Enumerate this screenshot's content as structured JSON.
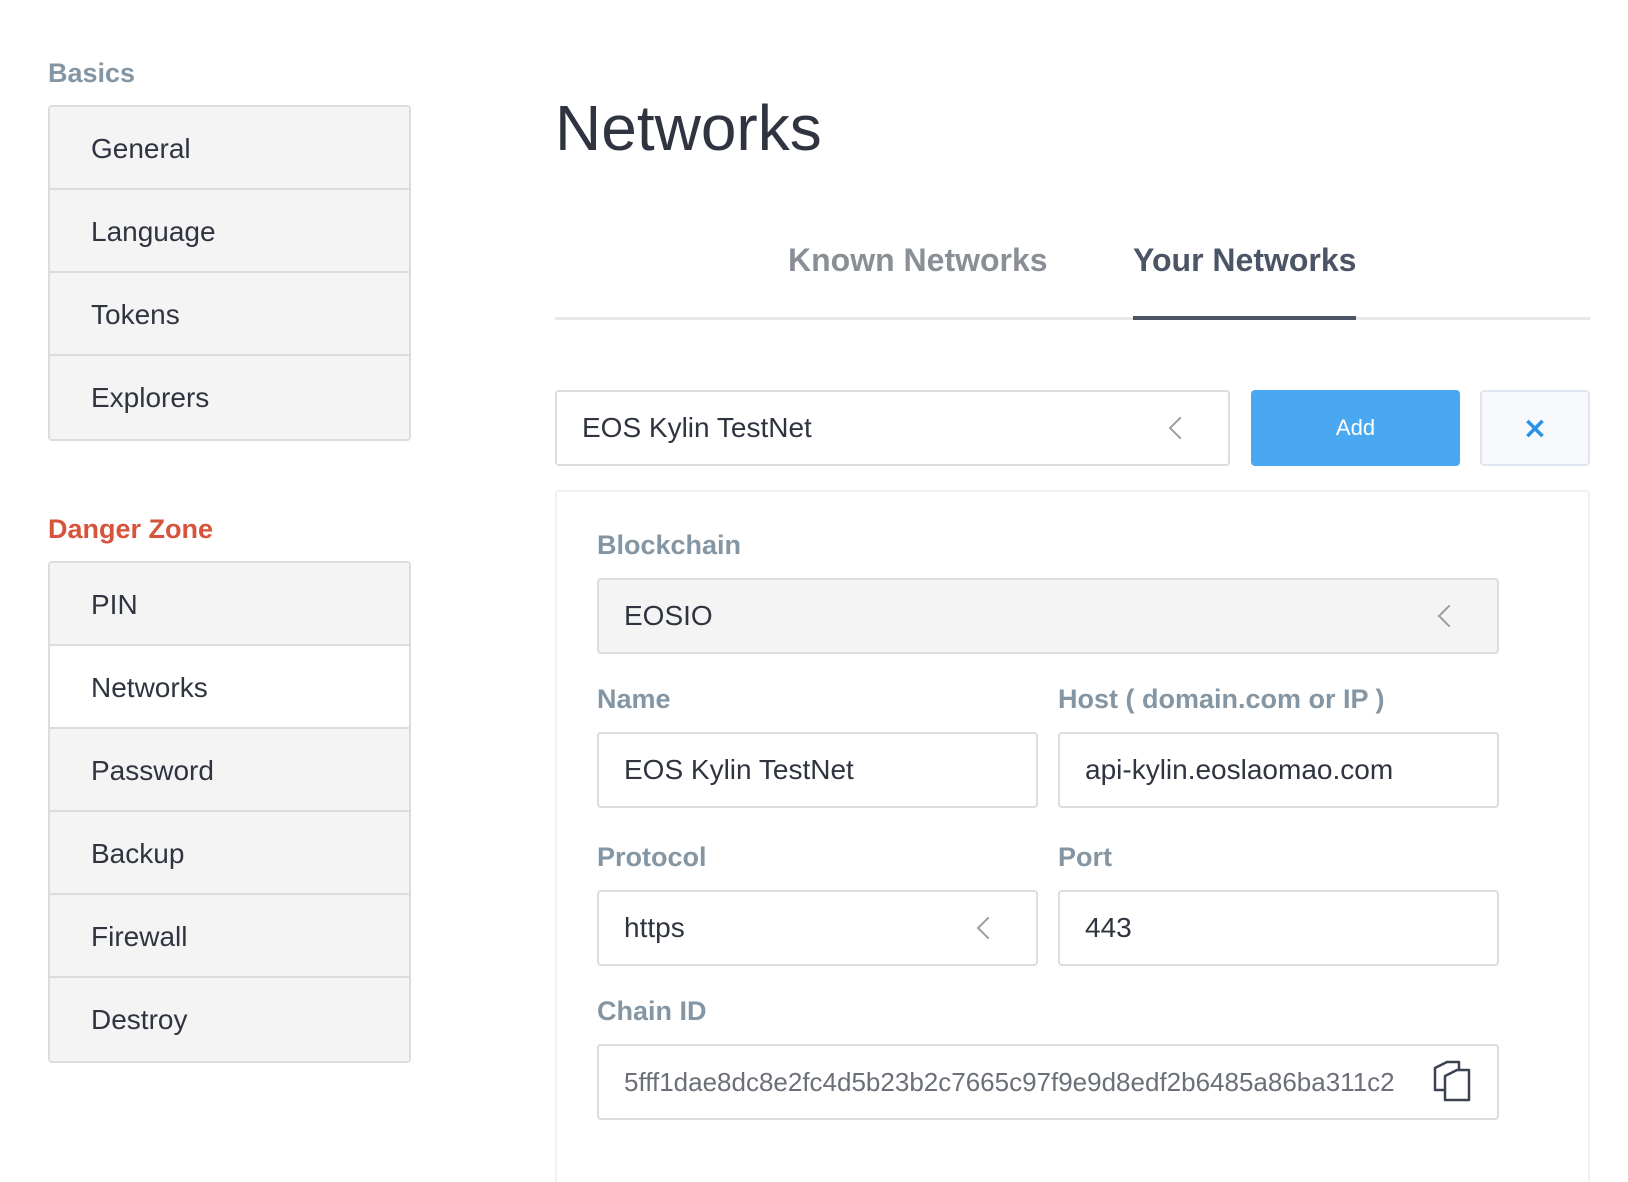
{
  "sidebar": {
    "basics_title": "Basics",
    "basics_items": [
      "General",
      "Language",
      "Tokens",
      "Explorers"
    ],
    "danger_title": "Danger Zone",
    "danger_items": [
      "PIN",
      "Networks",
      "Password",
      "Backup",
      "Firewall",
      "Destroy"
    ],
    "active_item": "Networks"
  },
  "main": {
    "title": "Networks",
    "tabs": {
      "known": "Known Networks",
      "yours": "Your Networks",
      "active": "Your Networks"
    },
    "network_select": {
      "value": "EOS Kylin TestNet"
    },
    "add_label": "Add",
    "close_label": "×"
  },
  "form": {
    "blockchain": {
      "label": "Blockchain",
      "value": "EOSIO"
    },
    "name": {
      "label": "Name",
      "value": "EOS Kylin TestNet"
    },
    "host": {
      "label": "Host ( domain.com or IP )",
      "value": "api-kylin.eoslaomao.com"
    },
    "protocol": {
      "label": "Protocol",
      "value": "https"
    },
    "port": {
      "label": "Port",
      "value": "443"
    },
    "chain_id": {
      "label": "Chain ID",
      "value": "5fff1dae8dc8e2fc4d5b23b2c7665c97f9e9d8edf2b6485a86ba311c2"
    }
  },
  "colors": {
    "accent": "#4aa8f0",
    "label": "#8496a3",
    "danger": "#d6533c",
    "active_tab": "#4b5566"
  },
  "icons": {
    "select_arrow": "chevron-left-icon",
    "copy": "copy-icon",
    "close": "close-icon"
  }
}
